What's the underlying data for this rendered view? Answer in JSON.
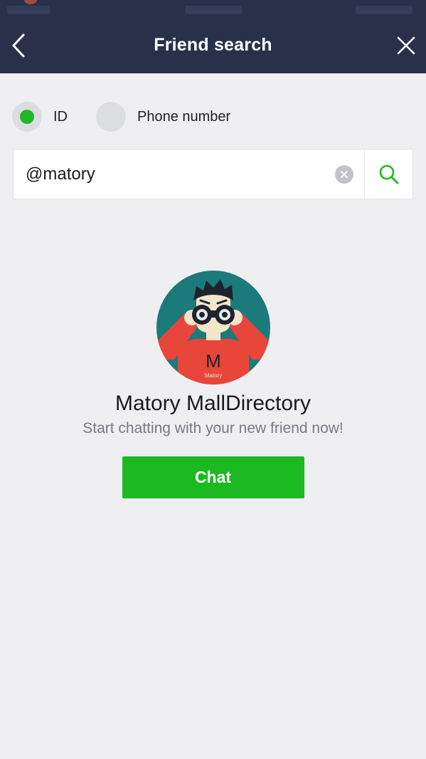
{
  "nav": {
    "title": "Friend search",
    "back_icon": "chevron-left-icon",
    "close_icon": "close-icon"
  },
  "search_type": {
    "options": [
      {
        "label": "ID",
        "selected": true
      },
      {
        "label": "Phone number",
        "selected": false
      }
    ]
  },
  "search": {
    "value": "@matory",
    "clear_icon": "clear-icon",
    "search_icon": "search-icon"
  },
  "result": {
    "name": "Matory MallDirectory",
    "subtitle": "Start chatting with your new friend now!",
    "chat_label": "Chat",
    "avatar": {
      "letter": "M",
      "caption": "Matory"
    }
  },
  "colors": {
    "nav_bg": "#283149",
    "accent_green": "#1db920",
    "page_bg": "#efeff2",
    "avatar_teal": "#1b7b7a",
    "avatar_red": "#e8463a"
  }
}
